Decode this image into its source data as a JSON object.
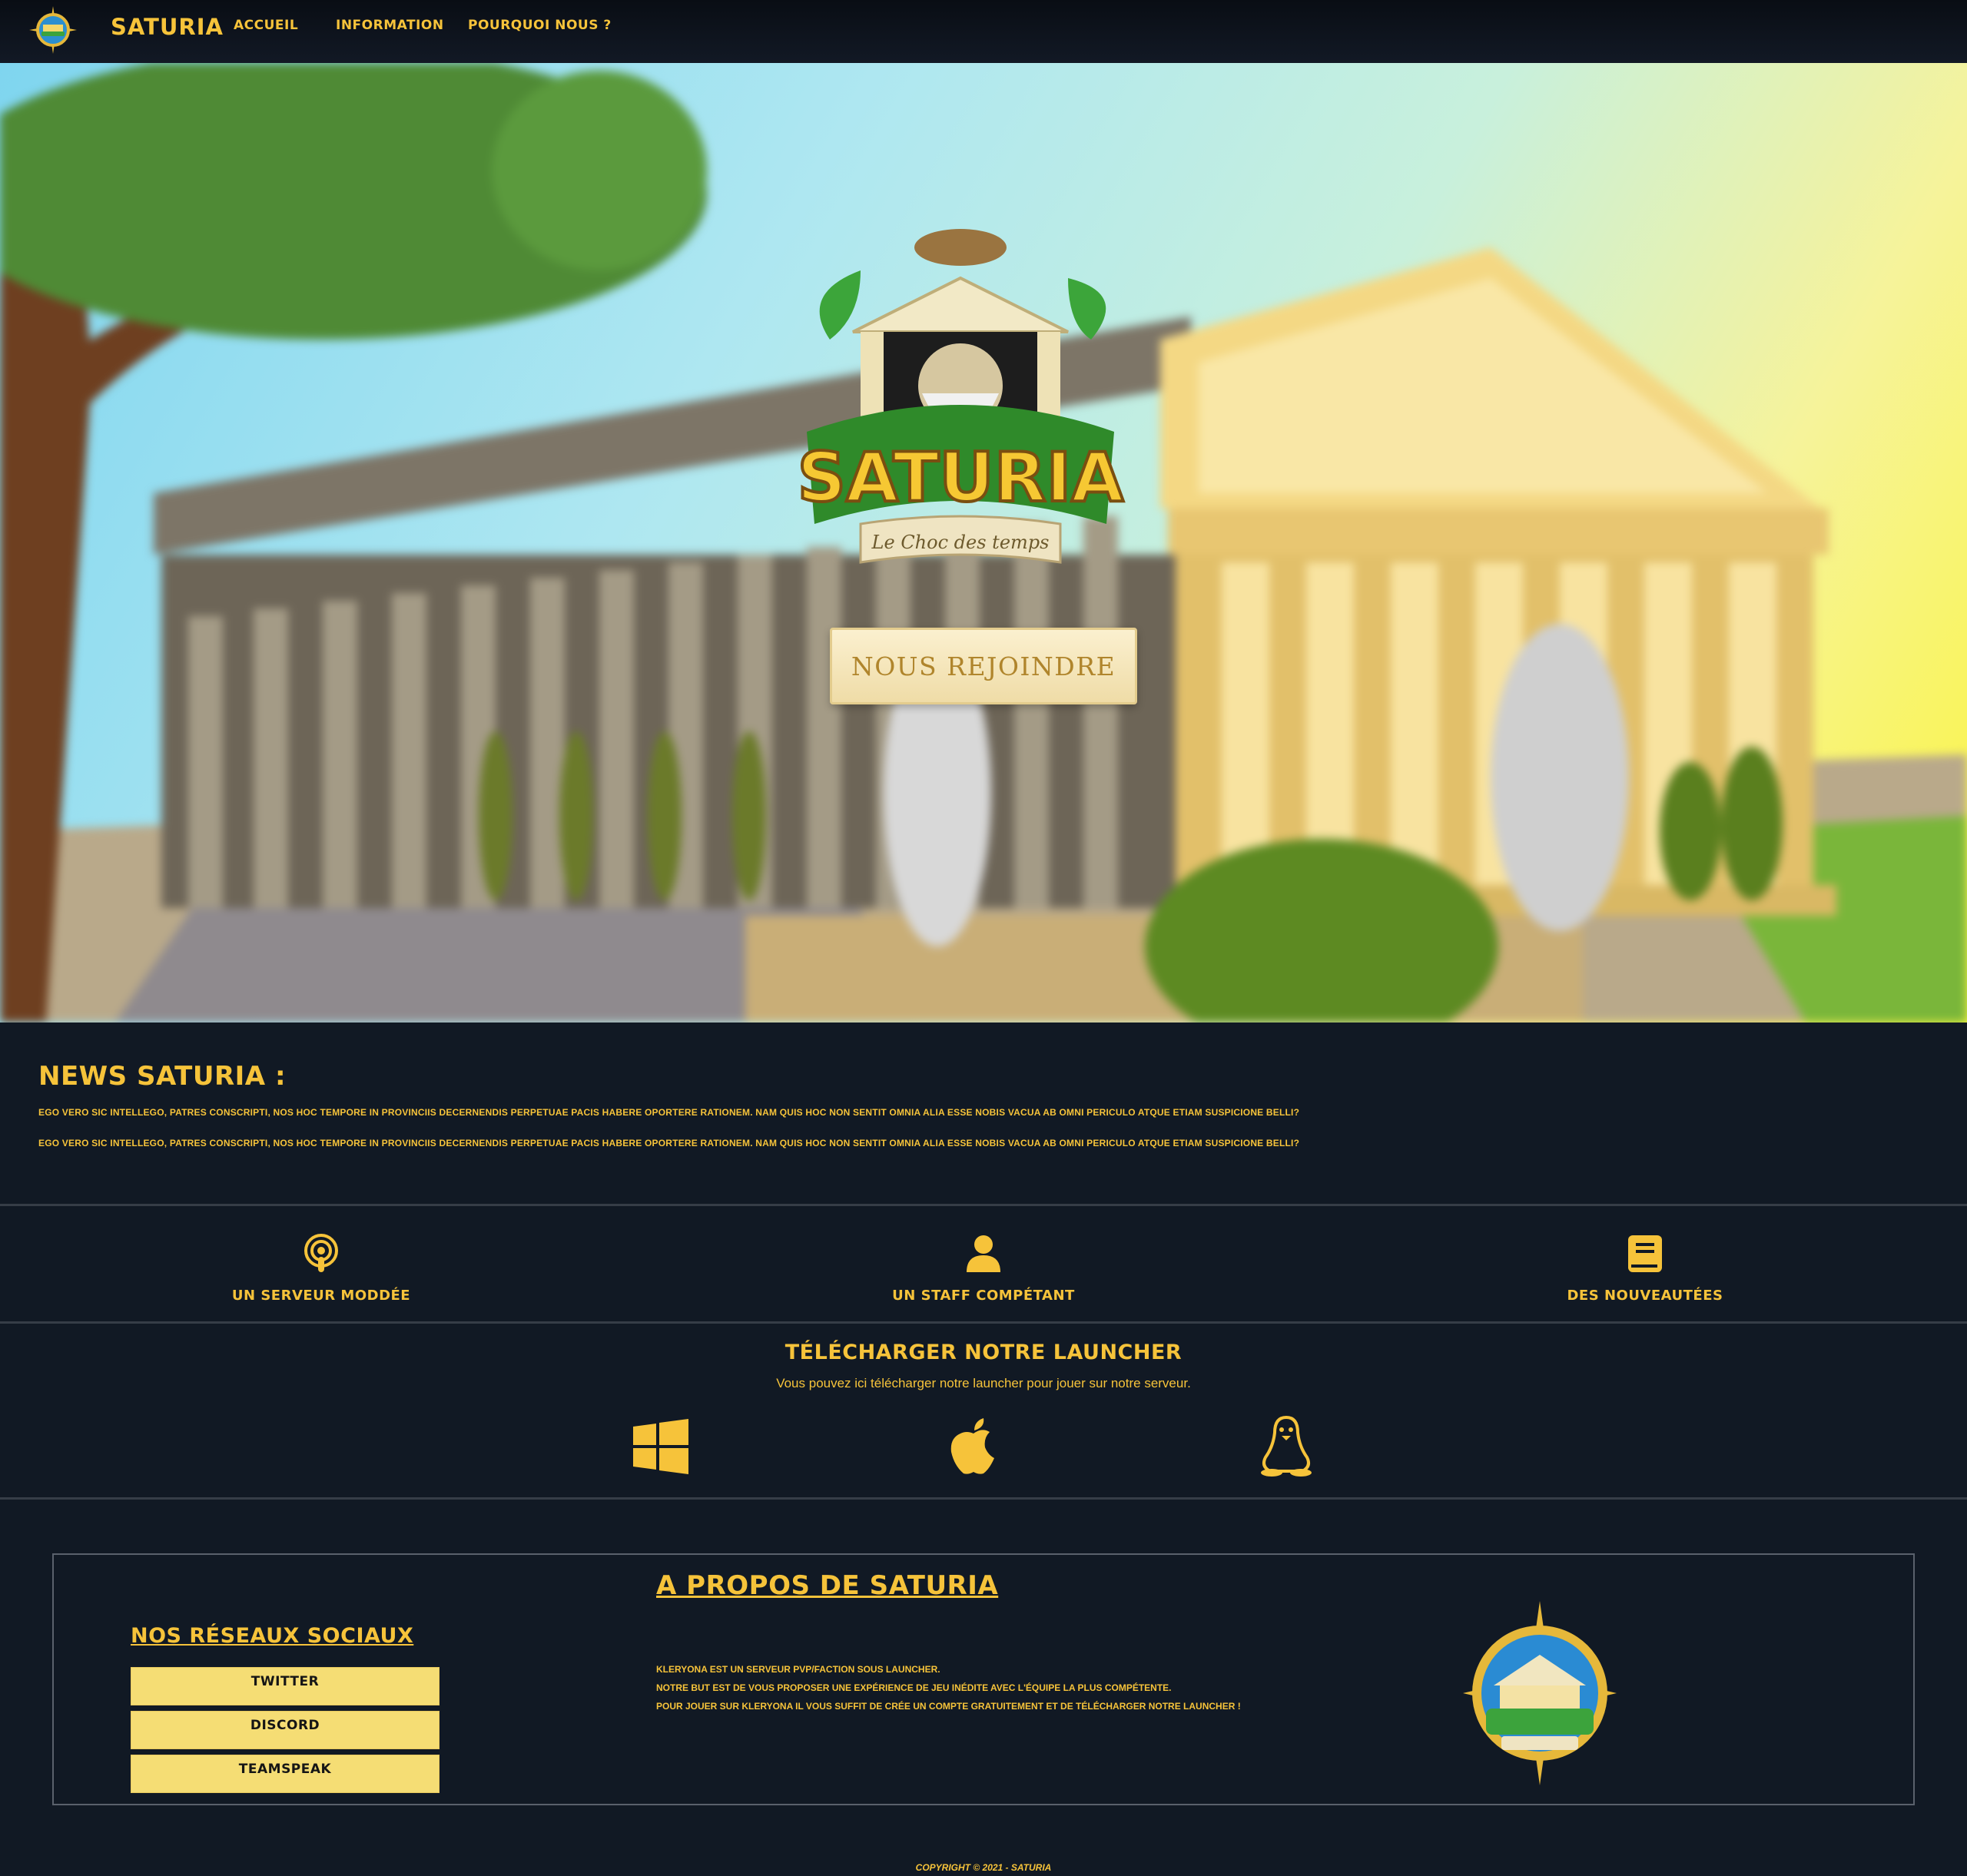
{
  "nav": {
    "brand": "SATURIA",
    "links": [
      "ACCUEIL",
      "INFORMATION",
      "POURQUOI NOUS ?"
    ]
  },
  "hero": {
    "logo_title": "SATURIA",
    "logo_tagline": "Le Choc des temps",
    "join_button": "NOUS REJOINDRE"
  },
  "news": {
    "title": "NEWS SATURIA :",
    "paragraphs": [
      "EGO VERO SIC INTELLEGO, PATRES CONSCRIPTI, NOS HOC TEMPORE IN PROVINCIIS DECERNENDIS PERPETUAE PACIS HABERE OPORTERE RATIONEM. NAM QUIS HOC NON SENTIT OMNIA ALIA ESSE NOBIS VACUA AB OMNI PERICULO ATQUE ETIAM SUSPICIONE BELLI?",
      "EGO VERO SIC INTELLEGO, PATRES CONSCRIPTI, NOS HOC TEMPORE IN PROVINCIIS DECERNENDIS PERPETUAE PACIS HABERE OPORTERE RATIONEM. NAM QUIS HOC NON SENTIT OMNIA ALIA ESSE NOBIS VACUA AB OMNI PERICULO ATQUE ETIAM SUSPICIONE BELLI?"
    ]
  },
  "features": [
    {
      "label": "UN SERVEUR MODDÉE",
      "icon": "podcast-icon"
    },
    {
      "label": "UN STAFF COMPÉTANT",
      "icon": "user-icon"
    },
    {
      "label": "DES NOUVEAUTÉES",
      "icon": "book-icon"
    }
  ],
  "download": {
    "title": "TÉLÉCHARGER NOTRE LAUNCHER",
    "subtitle": "Vous pouvez ici télécharger notre launcher pour jouer sur notre serveur.",
    "platforms": [
      "windows-icon",
      "apple-icon",
      "linux-icon"
    ]
  },
  "footer": {
    "social_title": "NOS RÉSEAUX SOCIAUX",
    "social_links": [
      "TWITTER",
      "DISCORD",
      "TEAMSPEAK"
    ],
    "about_title": "A PROPOS DE SATURIA",
    "about_lines": [
      "KLERYONA EST UN SERVEUR PVP/FACTION SOUS LAUNCHER.",
      "NOTRE BUT EST DE VOUS PROPOSER UNE EXPÉRIENCE DE JEU INÉDITE AVEC L'ÉQUIPE LA PLUS COMPÉTENTE.",
      "POUR JOUER SUR KLERYONA IL VOUS SUFFIT DE CRÉE UN COMPTE GRATUITEMENT ET DE TÉLÉCHARGER NOTRE LAUNCHER !"
    ],
    "copyright": "COPYRIGHT © 2021 - SATURIA"
  },
  "colors": {
    "accent": "#f6c33a",
    "background": "#111924",
    "button_bg": "#f5dd74"
  }
}
